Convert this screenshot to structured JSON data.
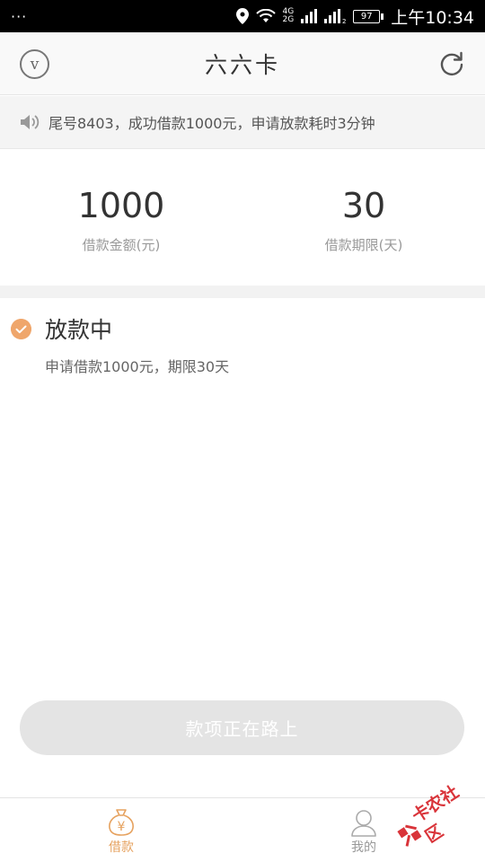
{
  "status_bar": {
    "dots": "···",
    "network_top": "4G",
    "network_bottom": "2G",
    "battery": "97",
    "time": "上午10:34"
  },
  "header": {
    "title": "六六卡",
    "left_icon_letter": "v"
  },
  "notice": {
    "text": "尾号8403，成功借款1000元，申请放款耗时3分钟"
  },
  "summary": {
    "amount_value": "1000",
    "amount_label": "借款金额(元)",
    "term_value": "30",
    "term_label": "借款期限(天)"
  },
  "loan_status": {
    "title": "放款中",
    "description": "申请借款1000元，期限30天"
  },
  "main_button": {
    "label": "款项正在路上"
  },
  "tabbar": {
    "loan_label": "借款",
    "mine_label": "我的",
    "loan_icon_glyph": "¥"
  },
  "watermark": {
    "text": "卡农社区"
  },
  "colors": {
    "accent": "#e6a25f",
    "check": "#efa66b",
    "button_disabled": "#e4e4e4",
    "watermark": "#d9343a"
  },
  "icons": {
    "header_left": "v-circle-icon",
    "header_right": "refresh-icon",
    "notice": "speaker-icon",
    "status": "check-circle-icon",
    "tab_loan": "money-bag-icon",
    "tab_mine": "user-icon"
  }
}
